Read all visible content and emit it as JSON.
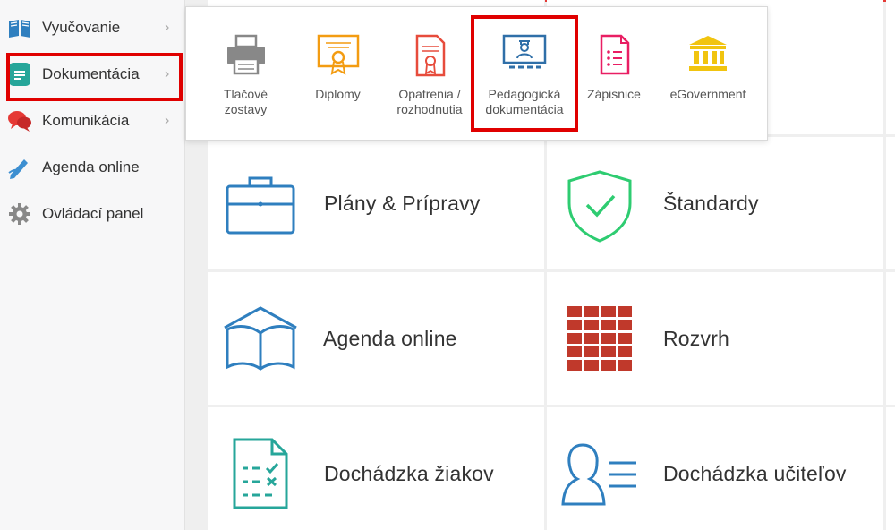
{
  "sidebar": {
    "items": [
      {
        "label": "Vyučovanie",
        "icon": "book-icon",
        "has_chevron": true
      },
      {
        "label": "Dokumentácia",
        "icon": "document-icon",
        "has_chevron": true
      },
      {
        "label": "Komunikácia",
        "icon": "chat-icon",
        "has_chevron": true
      },
      {
        "label": "Agenda online",
        "icon": "pencil-icon",
        "has_chevron": false
      },
      {
        "label": "Ovládací panel",
        "icon": "gear-icon",
        "has_chevron": false
      }
    ]
  },
  "dropdown": {
    "items": [
      {
        "label": "Tlačové\nzostavy",
        "icon": "printer-icon"
      },
      {
        "label": "Diplomy",
        "icon": "diploma-icon"
      },
      {
        "label": "Opatrenia /\nrozhodnutia",
        "icon": "certificate-icon"
      },
      {
        "label": "Pedagogická\ndokumentácia",
        "icon": "classroom-board-icon"
      },
      {
        "label": "Zápisnice",
        "icon": "list-document-icon"
      },
      {
        "label": "eGovernment",
        "icon": "government-building-icon"
      }
    ]
  },
  "tiles": [
    {
      "label": "Plány & Prípravy",
      "icon": "briefcase-icon"
    },
    {
      "label": "Štandardy",
      "icon": "shield-check-icon"
    },
    {
      "label": "Agenda online",
      "icon": "open-book-icon"
    },
    {
      "label": "Rozvrh",
      "icon": "timetable-grid-icon"
    },
    {
      "label": "Dochádzka žiakov",
      "icon": "attendance-checklist-icon"
    },
    {
      "label": "Dochádzka učiteľov",
      "icon": "teacher-profile-icon"
    }
  ],
  "colors": {
    "highlight": "#e00000",
    "accent_blue": "#2f7fbf",
    "teal": "#26a69a",
    "green": "#2ecc71",
    "red_brown": "#c0392b",
    "orange": "#f39c12",
    "pink": "#e91e63",
    "gold": "#f1c40f"
  }
}
